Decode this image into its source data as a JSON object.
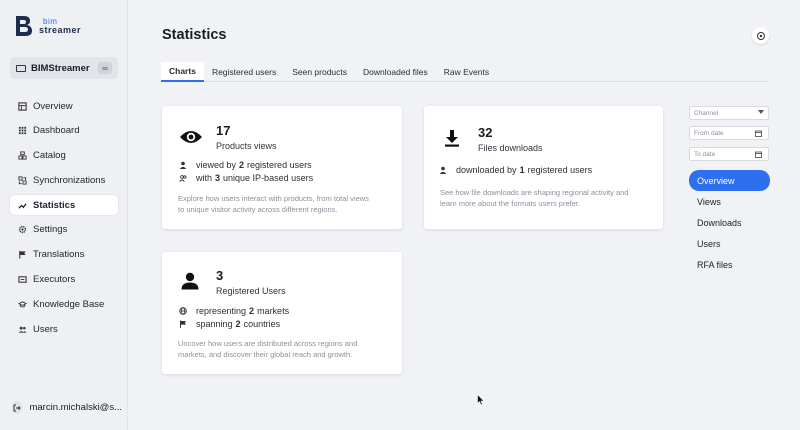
{
  "brand": {
    "logo_top": "bim",
    "logo_bottom": "streamer"
  },
  "workspace": {
    "name": "BIMStreamer"
  },
  "sidebar": {
    "items": [
      {
        "label": "Overview",
        "icon": "overview-icon"
      },
      {
        "label": "Dashboard",
        "icon": "grid-icon"
      },
      {
        "label": "Catalog",
        "icon": "catalog-icon"
      },
      {
        "label": "Synchronizations",
        "icon": "sync-icon"
      },
      {
        "label": "Statistics",
        "icon": "chart-icon",
        "active": true
      },
      {
        "label": "Settings",
        "icon": "gear-icon"
      },
      {
        "label": "Translations",
        "icon": "flag-icon"
      },
      {
        "label": "Executors",
        "icon": "executor-icon"
      },
      {
        "label": "Knowledge Base",
        "icon": "book-icon"
      },
      {
        "label": "Users",
        "icon": "users-icon"
      }
    ],
    "user": "marcin.michalski@s..."
  },
  "page": {
    "title": "Statistics"
  },
  "tabs": [
    {
      "label": "Charts",
      "active": true
    },
    {
      "label": "Registered users"
    },
    {
      "label": "Seen products"
    },
    {
      "label": "Downloaded files"
    },
    {
      "label": "Raw Events"
    }
  ],
  "cards": {
    "views": {
      "number": "17",
      "label": "Products views",
      "line1": {
        "pre": "viewed by",
        "value": "2",
        "post": "registered users"
      },
      "line2": {
        "pre": "with",
        "value": "3",
        "post": "unique IP-based users"
      },
      "desc1": "Explore how users interact with products, from total views",
      "desc2": "to unique visitor activity across different regions."
    },
    "downloads": {
      "number": "32",
      "label": "Files downloads",
      "line1": {
        "pre": "downloaded by",
        "value": "1",
        "post": "registered users"
      },
      "desc1": "See how file downloads are shaping regional activity and",
      "desc2": "learn more about the formats users prefer."
    },
    "users": {
      "number": "3",
      "label": "Registered Users",
      "line1": {
        "pre": "representing",
        "value": "2",
        "post": "markets"
      },
      "line2": {
        "pre": "spanning",
        "value": "2",
        "post": "countries"
      },
      "desc1": "Uncover how users are distributed across regions and",
      "desc2": "markets, and discover their global reach and growth."
    }
  },
  "filters": {
    "channel_placeholder": "Channel",
    "from_placeholder": "From date",
    "to_placeholder": "To date"
  },
  "side_list": [
    {
      "label": "Overview",
      "active": true
    },
    {
      "label": "Views"
    },
    {
      "label": "Downloads"
    },
    {
      "label": "Users"
    },
    {
      "label": "RFA files"
    }
  ],
  "colors": {
    "accent": "#2e6ff0",
    "background": "#f0f2f5",
    "card": "#ffffff"
  }
}
